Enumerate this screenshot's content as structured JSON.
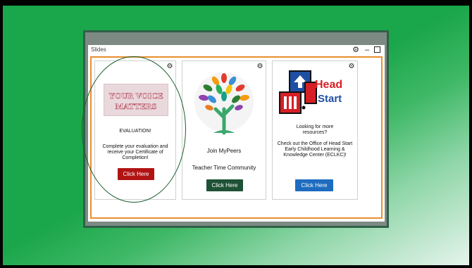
{
  "window": {
    "title": "Slides",
    "settings_icon": "gear-icon",
    "minimize_icon": "minimize-icon",
    "maximize_icon": "maximize-icon"
  },
  "colors": {
    "accent_border": "#e88f2e",
    "evaluation_button": "#b11313",
    "mypeers_button": "#1f5136",
    "headstart_button": "#1d6cc0"
  },
  "cards": [
    {
      "image_text": "YOUR VOICE MATTERS",
      "heading": "EVALUATION!",
      "body": "Complete your evaluation and receive your Certificate of Completion!",
      "button": "Click Here"
    },
    {
      "line1": "Join MyPeers",
      "line2": "Teacher Time Community",
      "button": "Click Here"
    },
    {
      "logo_word1": "Head",
      "logo_word2": "Start",
      "line1": "Looking for more resources?",
      "line2": "Check out the Office of Head Start Early Childhood Learning & Knowledge Center (ECLKC)!",
      "button": "Click Here"
    }
  ]
}
